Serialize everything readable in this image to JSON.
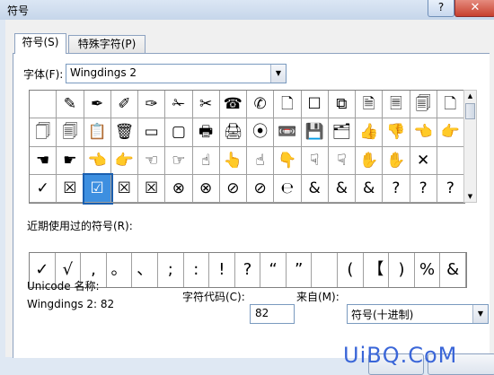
{
  "window": {
    "title": "符号",
    "help_label": "?",
    "close_label": "✕"
  },
  "tabs": [
    {
      "label": "符号(S)"
    },
    {
      "label": "特殊字符(P)"
    }
  ],
  "font": {
    "label": "字体(F):",
    "value": "Wingdings 2"
  },
  "symbol_grid": [
    [
      "",
      "✎",
      "✒",
      "✐",
      "✑",
      "✁",
      "✂",
      "☎",
      "✆",
      "🗋",
      "☐",
      "⧉",
      "🗎",
      "🗏",
      "🗐",
      "🗋"
    ],
    [
      "🗍",
      "🗐",
      "📋",
      "🗑",
      "▭",
      "▢",
      "🖶",
      "🖨",
      "⦿",
      "📼",
      "💾",
      "🗂",
      "👍",
      "👎",
      "👈",
      "👉"
    ],
    [
      "☚",
      "☛",
      "👈",
      "👉",
      "☜",
      "☞",
      "☝",
      "👆",
      "☝",
      "👇",
      "☟",
      "☟",
      "✋",
      "✋",
      "✕",
      ""
    ],
    [
      "✓",
      "☒",
      "☑",
      "☒",
      "☒",
      "⊗",
      "⊗",
      "⊘",
      "⊘",
      "℮",
      "&",
      "&",
      "&",
      "?",
      "?",
      "?"
    ]
  ],
  "selected_index": 2,
  "recent": {
    "label": "近期使用过的符号(R):",
    "symbols": [
      "✓",
      "√",
      ",",
      "。",
      "、",
      ";",
      ":",
      "!",
      "?",
      "“",
      "”",
      "",
      "(",
      "【",
      ")",
      "%",
      "&"
    ]
  },
  "unicode": {
    "label": "Unicode 名称:",
    "name": "Wingdings 2: 82"
  },
  "char_code": {
    "label": "字符代码(C):",
    "value": "82"
  },
  "from": {
    "label": "来自(M):",
    "value": "符号(十进制)"
  },
  "watermark": "UiBQ.CoM"
}
